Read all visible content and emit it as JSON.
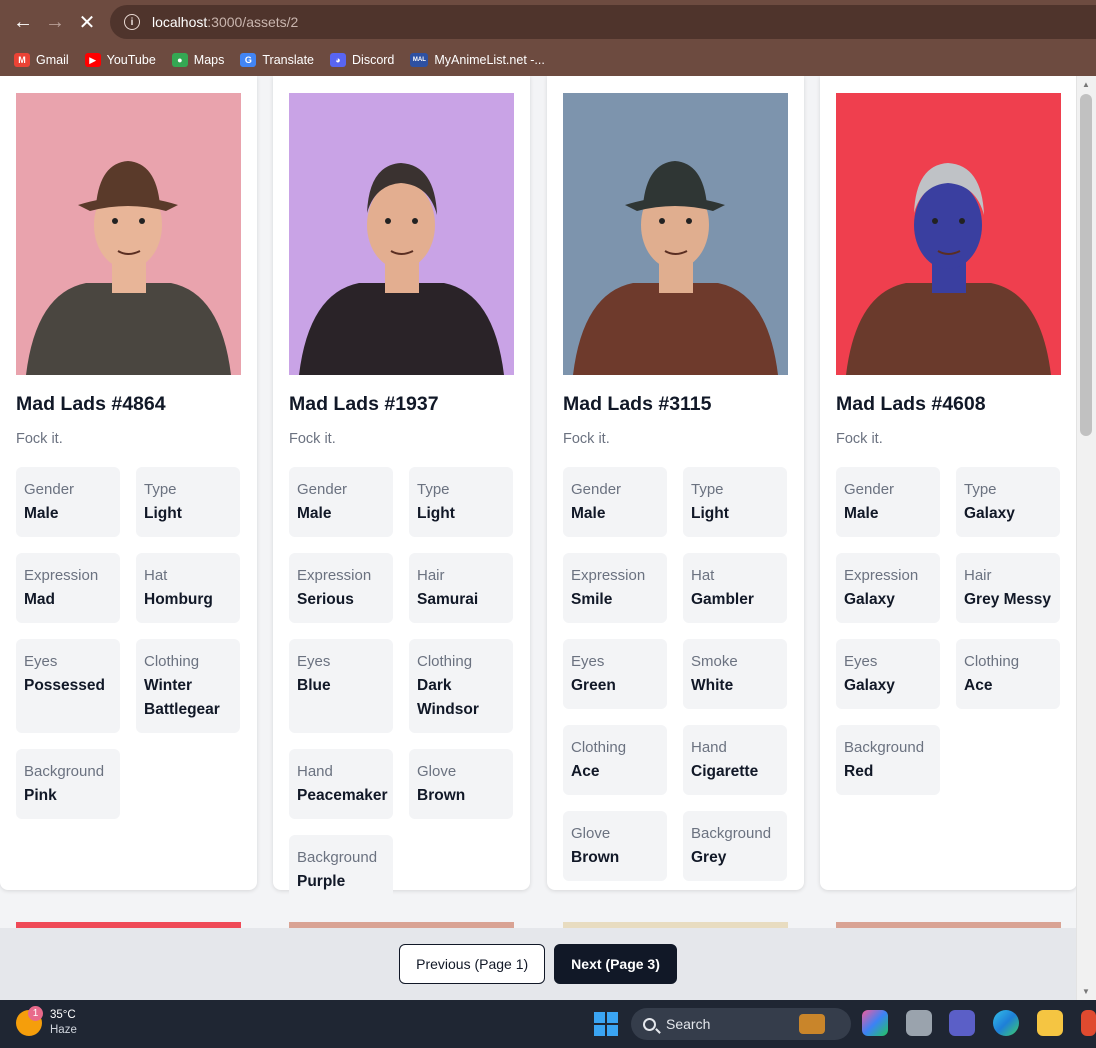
{
  "browser": {
    "url_host": "localhost",
    "url_path": ":3000/assets/2",
    "bookmarks": [
      {
        "label": "Gmail",
        "icon": "gmail-icon",
        "color": "#ea4335",
        "glyph": "M"
      },
      {
        "label": "YouTube",
        "icon": "youtube-icon",
        "color": "#ff0000",
        "glyph": "▶"
      },
      {
        "label": "Maps",
        "icon": "maps-icon",
        "color": "#34a853",
        "glyph": "●"
      },
      {
        "label": "Translate",
        "icon": "translate-icon",
        "color": "#4285f4",
        "glyph": "G"
      },
      {
        "label": "Discord",
        "icon": "discord-icon",
        "color": "#5865f2",
        "glyph": "◕"
      },
      {
        "label": "MyAnimeList.net -...",
        "icon": "myanimelist-icon",
        "color": "#2e51a2",
        "glyph": "MAL"
      }
    ]
  },
  "cards": [
    {
      "title": "Mad Lads #4864",
      "description": "Fock it.",
      "bg": "#e9a3ad",
      "skin": "#e8b598",
      "hair": "#2b2420",
      "hat": "#5a3a2a",
      "coat": "#4a4640",
      "attributes": [
        {
          "key": "Gender",
          "value": "Male"
        },
        {
          "key": "Type",
          "value": "Light"
        },
        {
          "key": "Expression",
          "value": "Mad"
        },
        {
          "key": "Hat",
          "value": "Homburg"
        },
        {
          "key": "Eyes",
          "value": "Possessed"
        },
        {
          "key": "Clothing",
          "value": "Winter Battlegear"
        },
        {
          "key": "Background",
          "value": "Pink"
        }
      ]
    },
    {
      "title": "Mad Lads #1937",
      "description": "Fock it.",
      "bg": "#c9a3e6",
      "skin": "#e3ae90",
      "hair": "#3a3230",
      "hat": "",
      "coat": "#2a2328",
      "attributes": [
        {
          "key": "Gender",
          "value": "Male"
        },
        {
          "key": "Type",
          "value": "Light"
        },
        {
          "key": "Expression",
          "value": "Serious"
        },
        {
          "key": "Hair",
          "value": "Samurai"
        },
        {
          "key": "Eyes",
          "value": "Blue"
        },
        {
          "key": "Clothing",
          "value": "Dark Windsor"
        },
        {
          "key": "Hand",
          "value": "Peacemaker"
        },
        {
          "key": "Glove",
          "value": "Brown"
        },
        {
          "key": "Background",
          "value": "Purple"
        }
      ]
    },
    {
      "title": "Mad Lads #3115",
      "description": "Fock it.",
      "bg": "#7d94ad",
      "skin": "#e0ae8f",
      "hair": "#2b2420",
      "hat": "#2f3634",
      "coat": "#6e3a2c",
      "attributes": [
        {
          "key": "Gender",
          "value": "Male"
        },
        {
          "key": "Type",
          "value": "Light"
        },
        {
          "key": "Expression",
          "value": "Smile"
        },
        {
          "key": "Hat",
          "value": "Gambler"
        },
        {
          "key": "Eyes",
          "value": "Green"
        },
        {
          "key": "Smoke",
          "value": "White"
        },
        {
          "key": "Clothing",
          "value": "Ace"
        },
        {
          "key": "Hand",
          "value": "Cigarette"
        },
        {
          "key": "Glove",
          "value": "Brown"
        },
        {
          "key": "Background",
          "value": "Grey"
        }
      ]
    },
    {
      "title": "Mad Lads #4608",
      "description": "Fock it.",
      "bg": "#ef3f4e",
      "skin": "#3a3fa0",
      "hair": "#bfc2c6",
      "hat": "",
      "coat": "#6a3a2c",
      "attributes": [
        {
          "key": "Gender",
          "value": "Male"
        },
        {
          "key": "Type",
          "value": "Galaxy"
        },
        {
          "key": "Expression",
          "value": "Galaxy"
        },
        {
          "key": "Hair",
          "value": "Grey Messy"
        },
        {
          "key": "Eyes",
          "value": "Galaxy"
        },
        {
          "key": "Clothing",
          "value": "Ace"
        },
        {
          "key": "Background",
          "value": "Red"
        }
      ]
    }
  ],
  "pagination": {
    "previous_label": "Previous (Page 1)",
    "next_label": "Next (Page 3)"
  },
  "taskbar": {
    "temperature": "35°C",
    "condition": "Haze",
    "weather_badge": "1",
    "search_label": "Search"
  }
}
